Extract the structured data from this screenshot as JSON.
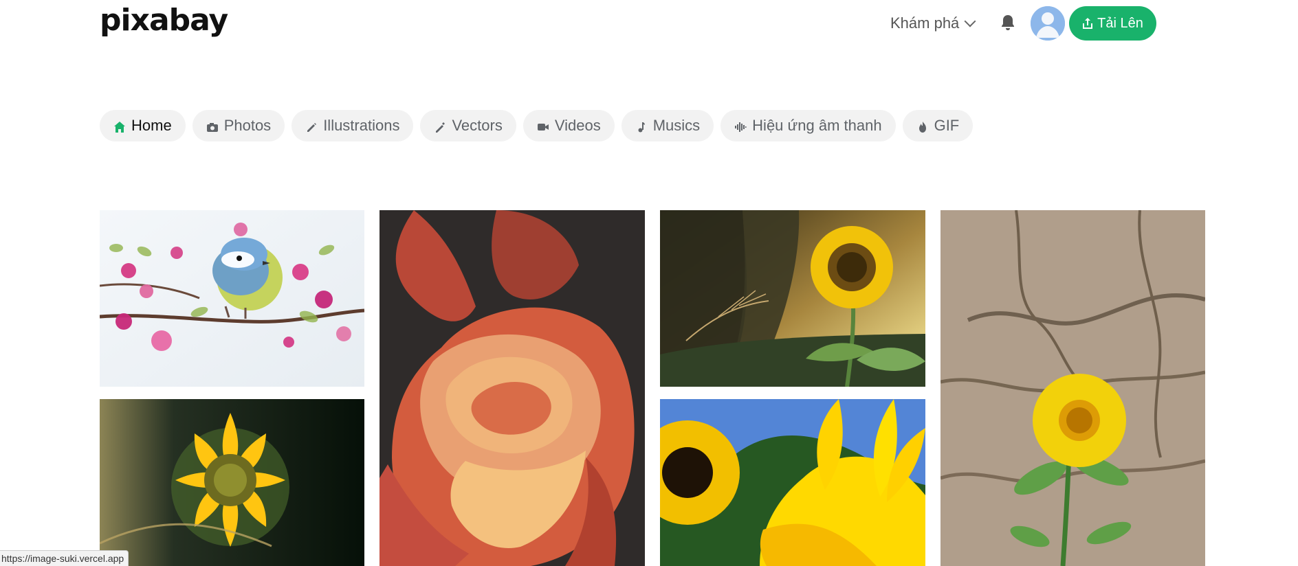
{
  "header": {
    "logo": "pixabay",
    "explore_label": "Khám phá",
    "upload_label": "Tải Lên"
  },
  "categories": [
    {
      "label": "Home",
      "icon": "home-icon",
      "active": true
    },
    {
      "label": "Photos",
      "icon": "camera-icon",
      "active": false
    },
    {
      "label": "Illustrations",
      "icon": "pencil-icon",
      "active": false
    },
    {
      "label": "Vectors",
      "icon": "pen-icon",
      "active": false
    },
    {
      "label": "Videos",
      "icon": "video-icon",
      "active": false
    },
    {
      "label": "Musics",
      "icon": "music-icon",
      "active": false
    },
    {
      "label": "Hiệu ứng âm thanh",
      "icon": "sound-wave-icon",
      "active": false
    },
    {
      "label": "GIF",
      "icon": "flame-icon",
      "active": false
    }
  ],
  "gallery": {
    "images": [
      {
        "subject": "blue tit on blossom branch"
      },
      {
        "subject": "orange rose close-up"
      },
      {
        "subject": "sunflower at sunset"
      },
      {
        "subject": "yellow flower on cracked earth"
      },
      {
        "subject": "sunflower on dark background"
      },
      {
        "subject": "sunflowers under blue sky"
      }
    ]
  },
  "status_bar": {
    "url": "https://image-suki.vercel.app"
  },
  "colors": {
    "accent": "#19b26b",
    "pill_bg": "#f2f2f2",
    "active_icon": "#19b26b"
  }
}
